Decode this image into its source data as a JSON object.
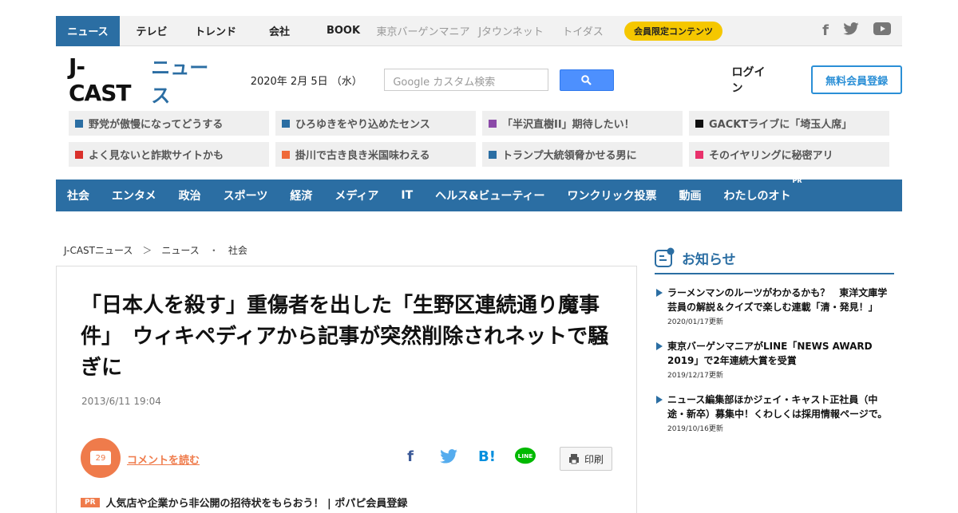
{
  "topnav": {
    "items": [
      "ニュース",
      "テレビ",
      "トレンド",
      "会社",
      "BOOK"
    ],
    "sub_items": [
      "東京バーゲンマニア",
      "Jタウンネット",
      "トイダス"
    ],
    "member": "会員限定コンテンツ",
    "social": [
      "facebook-icon",
      "twitter-icon",
      "youtube-icon"
    ]
  },
  "header": {
    "logo_main": "J-CAST",
    "logo_sub": "ニュース",
    "date": "2020年 2月 5日 （水）",
    "search_placeholder": "Google カスタム検索",
    "login": "ログイン",
    "register": "無料会員登録"
  },
  "trending": [
    {
      "text": "野党が傲慢になってどうする",
      "color": "#2b6ea3"
    },
    {
      "text": "ひろゆきをやり込めたセンス",
      "color": "#2b6ea3"
    },
    {
      "text": "「半沢直樹II」期待したい！",
      "color": "#8b4aa8"
    },
    {
      "text": "GACKTライブに「埼玉人席」",
      "color": "#111111"
    },
    {
      "text": "よく見ないと詐欺サイトかも",
      "color": "#d9302b"
    },
    {
      "text": "掛川で古き良き米国味わえる",
      "color": "#ef6a3a"
    },
    {
      "text": "トランプ大統領脅かせる男に",
      "color": "#2b6ea3"
    },
    {
      "text": "そのイヤリングに秘密アリ",
      "color": "#e8316b"
    }
  ],
  "catnav": [
    "社会",
    "エンタメ",
    "政治",
    "スポーツ",
    "経済",
    "メディア",
    "IT",
    "ヘルス&ビューティー",
    "ワンクリック投票",
    "動画",
    "わたしのオト"
  ],
  "catnav_pr": "PR",
  "breadcrumb": [
    "J-CASTニュース",
    "＞",
    "ニュース",
    "・",
    "社会"
  ],
  "article": {
    "title": "「日本人を殺す」重傷者を出した「生野区連続通り魔事件」　ウィキペディアから記事が突然削除されネットで騒ぎに",
    "date": "2013/6/11 19:04",
    "comment_count": "29",
    "comment_link": "コメントを読む",
    "print": "印刷",
    "promo_badge": "PR",
    "promo": "人気店や企業から非公開の招待状をもらおう！ | ポパピ会員登録"
  },
  "sidebar": {
    "title": "お知らせ",
    "news": [
      {
        "text": "ラーメンマンのルーツがわかるかも？　東洋文庫学芸員の解説＆クイズで楽しむ連載「清・発見！」",
        "date": "2020/01/17更新"
      },
      {
        "text": "東京バーゲンマニアがLINE「NEWS AWARD 2019」で2年連続大賞を受賞",
        "date": "2019/12/17更新"
      },
      {
        "text": "ニュース編集部ほかジェイ・キャスト正社員（中途・新卒）募集中！くわしくは採用情報ページで。",
        "date": "2019/10/16更新"
      }
    ]
  }
}
